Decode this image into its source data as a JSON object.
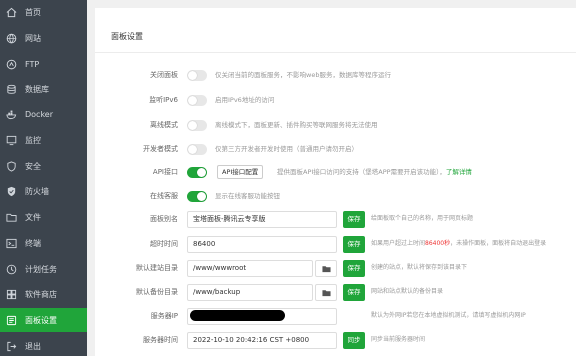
{
  "sidebar": {
    "items": [
      {
        "label": "首页",
        "icon": "home-icon"
      },
      {
        "label": "网站",
        "icon": "globe-icon"
      },
      {
        "label": "FTP",
        "icon": "ftp-icon"
      },
      {
        "label": "数据库",
        "icon": "database-icon"
      },
      {
        "label": "Docker",
        "icon": "docker-icon"
      },
      {
        "label": "监控",
        "icon": "monitor-icon"
      },
      {
        "label": "安全",
        "icon": "shield-icon"
      },
      {
        "label": "防火墙",
        "icon": "firewall-icon"
      },
      {
        "label": "文件",
        "icon": "folder-icon"
      },
      {
        "label": "终端",
        "icon": "terminal-icon"
      },
      {
        "label": "计划任务",
        "icon": "clock-icon"
      },
      {
        "label": "软件商店",
        "icon": "store-icon"
      },
      {
        "label": "面板设置",
        "icon": "settings-icon",
        "active": true
      },
      {
        "label": "退出",
        "icon": "logout-icon"
      }
    ]
  },
  "panel": {
    "title": "面板设置",
    "toggles": [
      {
        "label": "关闭面板",
        "desc": "仅关闭当前的面板服务，不影响web服务，数据库等程序运行",
        "on": false
      },
      {
        "label": "监听IPv6",
        "desc": "启用IPv6地址的访问",
        "on": false
      },
      {
        "label": "离线模式",
        "desc": "离线模式下，面板更新、插件购买等联网服务将无法使用",
        "on": false
      },
      {
        "label": "开发者模式",
        "desc": "仅第三方开发者开发时使用（普通用户请勿开启）",
        "on": false
      }
    ],
    "api": {
      "label": "API接口",
      "on": true,
      "button": "API接口配置",
      "desc": "提供面板API接口访问的支持（堡塔APP需要开启该功能），",
      "link": "了解详情"
    },
    "customer_service": {
      "label": "在线客服",
      "on": true,
      "desc": "显示在线客服功能按钮"
    },
    "panel_alias": {
      "label": "面板别名",
      "value": "宝塔面板-腾讯云专享版",
      "save": "保存",
      "desc": "给面板取个自己的名称，用于网页标题"
    },
    "timeout": {
      "label": "超时时间",
      "value": "86400",
      "save": "保存",
      "desc_pre": "如果用户超过上时间",
      "desc_red": "86400秒",
      "desc_post": "，未操作面板，面板将自动退出登录"
    },
    "default_site_dir": {
      "label": "默认建站目录",
      "value": "/www/wwwroot",
      "save": "保存",
      "desc": "创建的站点，默认将保存到该目录下"
    },
    "default_backup_dir": {
      "label": "默认备份目录",
      "value": "/www/backup",
      "save": "保存",
      "desc": "网站和站点默认的备份目录"
    },
    "server_ip": {
      "label": "服务器IP",
      "desc": "默认为外网IP若您在本地虚拟机测试，请填写虚拟机内网IP"
    },
    "server_time": {
      "label": "服务器时间",
      "value": "2022-10-10 20:42:16 CST +0800",
      "sync": "同步",
      "desc": "同步当前服务器时间"
    }
  },
  "colors": {
    "accent": "#20a53a",
    "sidebar_bg": "#3c444d",
    "warning_red": "#ee3333"
  }
}
